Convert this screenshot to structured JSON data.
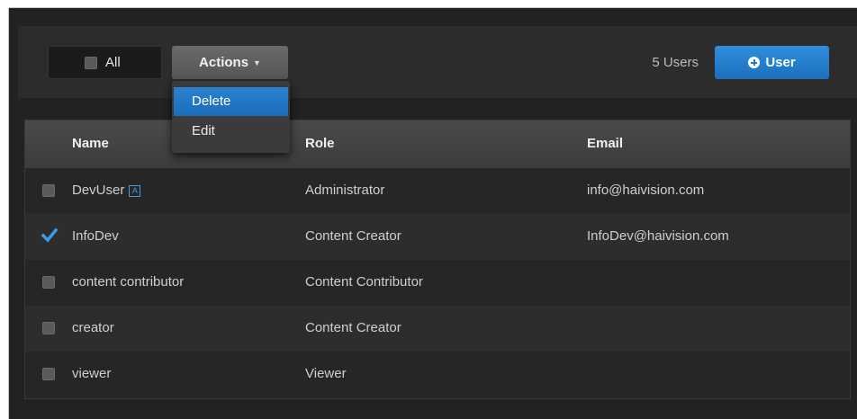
{
  "toolbar": {
    "select_all_label": "All",
    "actions_label": "Actions",
    "user_count": "5 Users",
    "add_user_label": "User"
  },
  "actions_menu": {
    "items": [
      "Delete",
      "Edit"
    ],
    "highlighted": "Delete"
  },
  "table": {
    "columns": [
      "Name",
      "Role",
      "Email"
    ],
    "rows": [
      {
        "name": "DevUser",
        "badge": "A",
        "role": "Administrator",
        "email": "info@haivision.com",
        "checked": false
      },
      {
        "name": "InfoDev",
        "role": "Content Creator",
        "email": "InfoDev@haivision.com",
        "checked": true
      },
      {
        "name": "content contributor",
        "role": "Content Contributor",
        "email": "",
        "checked": false
      },
      {
        "name": "creator",
        "role": "Content Creator",
        "email": "",
        "checked": false
      },
      {
        "name": "viewer",
        "role": "Viewer",
        "email": "",
        "checked": false
      }
    ]
  },
  "colors": {
    "accent": "#1f78c8",
    "background": "#222222",
    "checkmark": "#3b9be6"
  }
}
